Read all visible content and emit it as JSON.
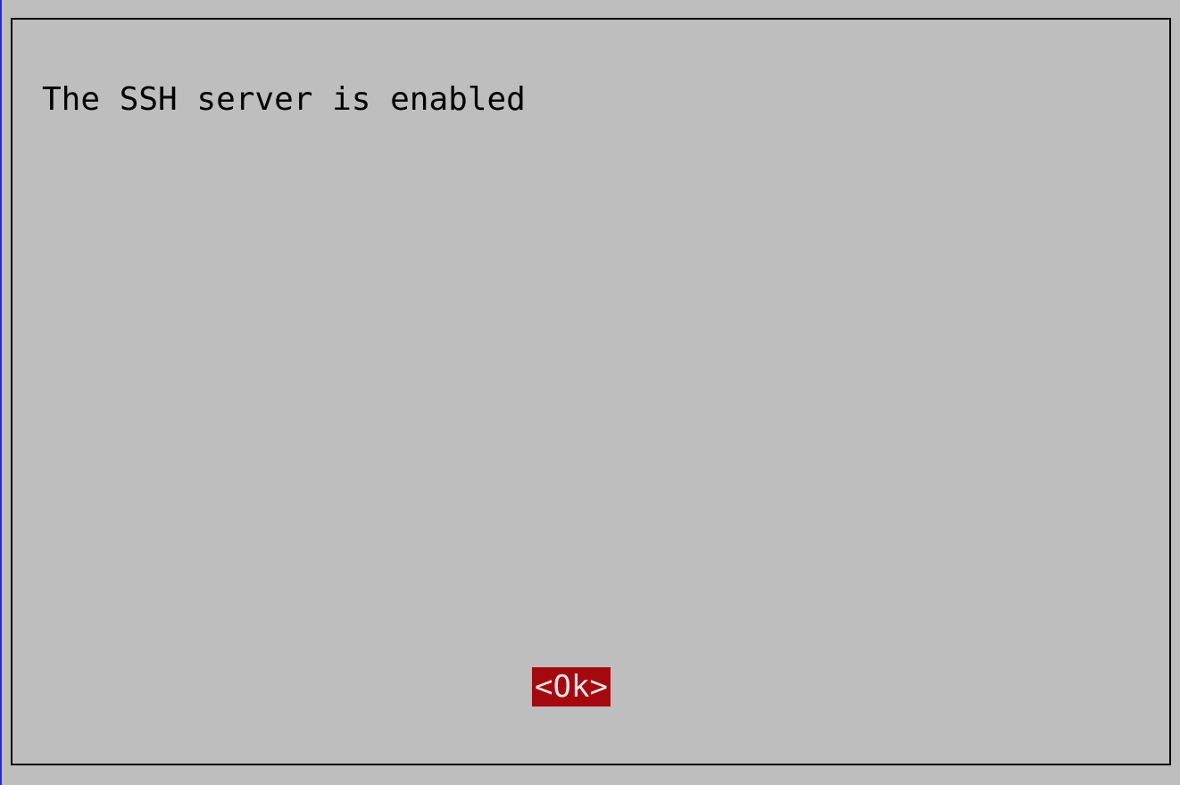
{
  "dialog": {
    "message": "The SSH server is enabled",
    "ok_label": "<Ok>"
  },
  "colors": {
    "background": "#bebebe",
    "border": "#000000",
    "button_bg": "#a50910",
    "button_text": "#e6e6e6",
    "left_edge": "#2a2ad0"
  }
}
